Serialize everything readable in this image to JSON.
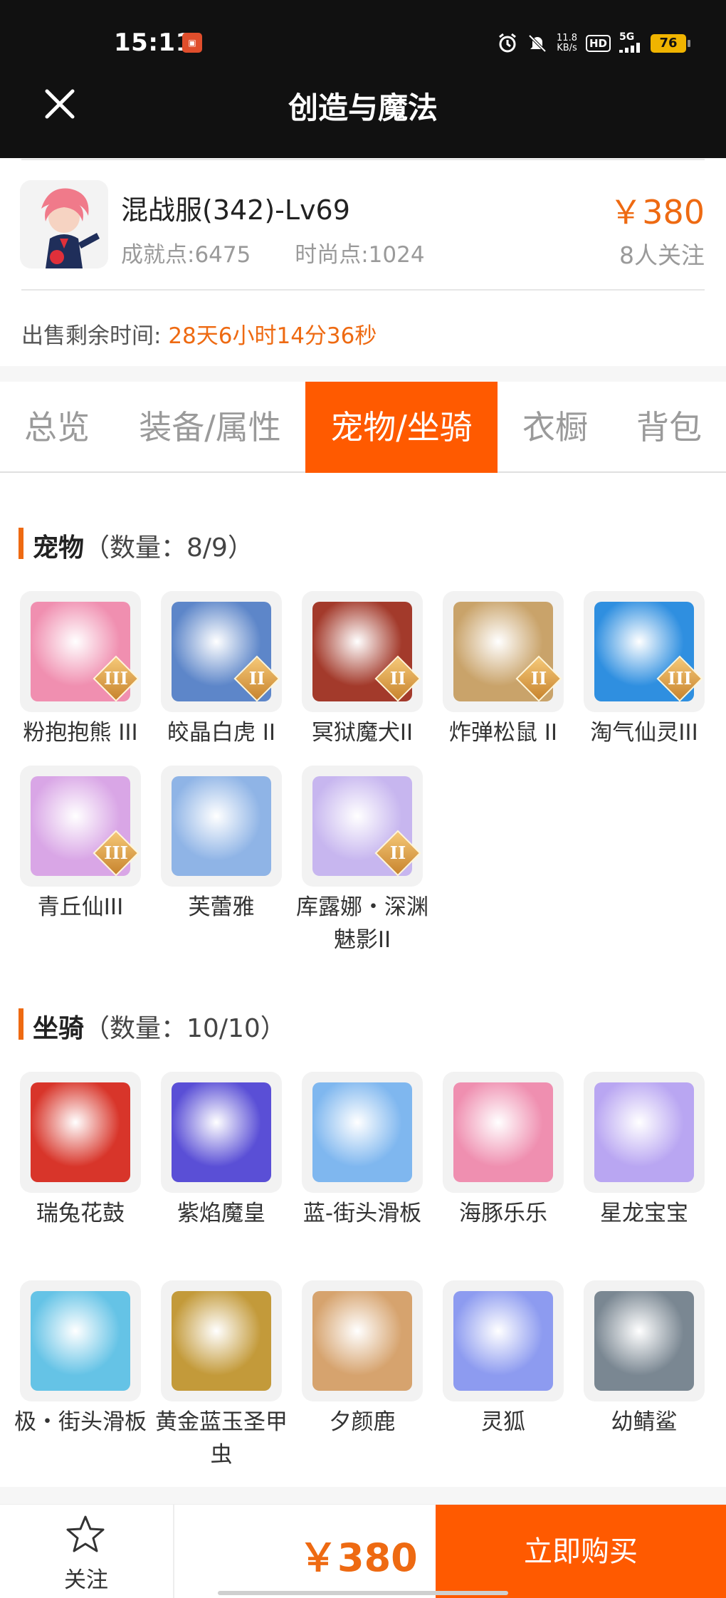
{
  "status_bar": {
    "time": "15:11",
    "net_speed_value": "11.8",
    "net_speed_unit": "KB/s",
    "hd": "HD",
    "network": "5G",
    "battery": "76",
    "icons": [
      "app-icon",
      "alarm-icon",
      "mute-icon",
      "signal-icon"
    ]
  },
  "header": {
    "title": "创造与魔法",
    "close_icon": "close-icon"
  },
  "listing": {
    "character": "混战服(342)-Lv69",
    "price": "￥380",
    "achievement": "成就点:6475",
    "fashion": "时尚点:1024",
    "followers": "8人关注",
    "remaining_label": "出售剩余时间:",
    "remaining_value": "28天6小时14分36秒"
  },
  "tabs": [
    {
      "label": "总览"
    },
    {
      "label": "装备/属性"
    },
    {
      "label": "宠物/坐骑",
      "active": true
    },
    {
      "label": "衣橱"
    },
    {
      "label": "背包"
    }
  ],
  "pets": {
    "title": "宠物",
    "count": "（数量：8/9）",
    "items": [
      {
        "name": "粉抱抱熊 III",
        "badge": "III",
        "color": "#f08fb0"
      },
      {
        "name": "皎晶白虎 II",
        "badge": "II",
        "color": "#5d86c9"
      },
      {
        "name": "冥狱魔犬II",
        "badge": "II",
        "color": "#a33a2b"
      },
      {
        "name": "炸弹松鼠 II",
        "badge": "II",
        "color": "#c9a36a"
      },
      {
        "name": "淘气仙灵III",
        "badge": "III",
        "color": "#2f8fe0"
      },
      {
        "name": "青丘仙III",
        "badge": "III",
        "color": "#d9a6e6"
      },
      {
        "name": "芙蕾雅",
        "badge": "",
        "color": "#8fb4e6"
      },
      {
        "name": "库露娜・深渊魅影II",
        "badge": "II",
        "color": "#c7b6ef"
      }
    ]
  },
  "mounts": {
    "title": "坐骑",
    "count": "（数量：10/10）",
    "items": [
      {
        "name": "瑞兔花鼓",
        "color": "#d8352a"
      },
      {
        "name": "紫焰魔皇",
        "color": "#5a4fd6"
      },
      {
        "name": "蓝-街头滑板",
        "color": "#7fb7ef"
      },
      {
        "name": "海豚乐乐",
        "color": "#ef8fb0"
      },
      {
        "name": "星龙宝宝",
        "color": "#b9a6f2"
      },
      {
        "name": "极・街头滑板",
        "color": "#65c3e6"
      },
      {
        "name": "黄金蓝玉圣甲虫",
        "color": "#c39a3a"
      },
      {
        "name": "夕颜鹿",
        "color": "#d6a36e"
      },
      {
        "name": "灵狐",
        "color": "#8d9bf0"
      },
      {
        "name": "幼鲭鲨",
        "color": "#7a8792"
      }
    ]
  },
  "bottom_bar": {
    "follow_label": "关注",
    "price": "￥380",
    "buy_label": "立即购买"
  },
  "colors": {
    "accent": "#ff5a00",
    "price": "#ee6a12",
    "header_bg": "#111111"
  }
}
